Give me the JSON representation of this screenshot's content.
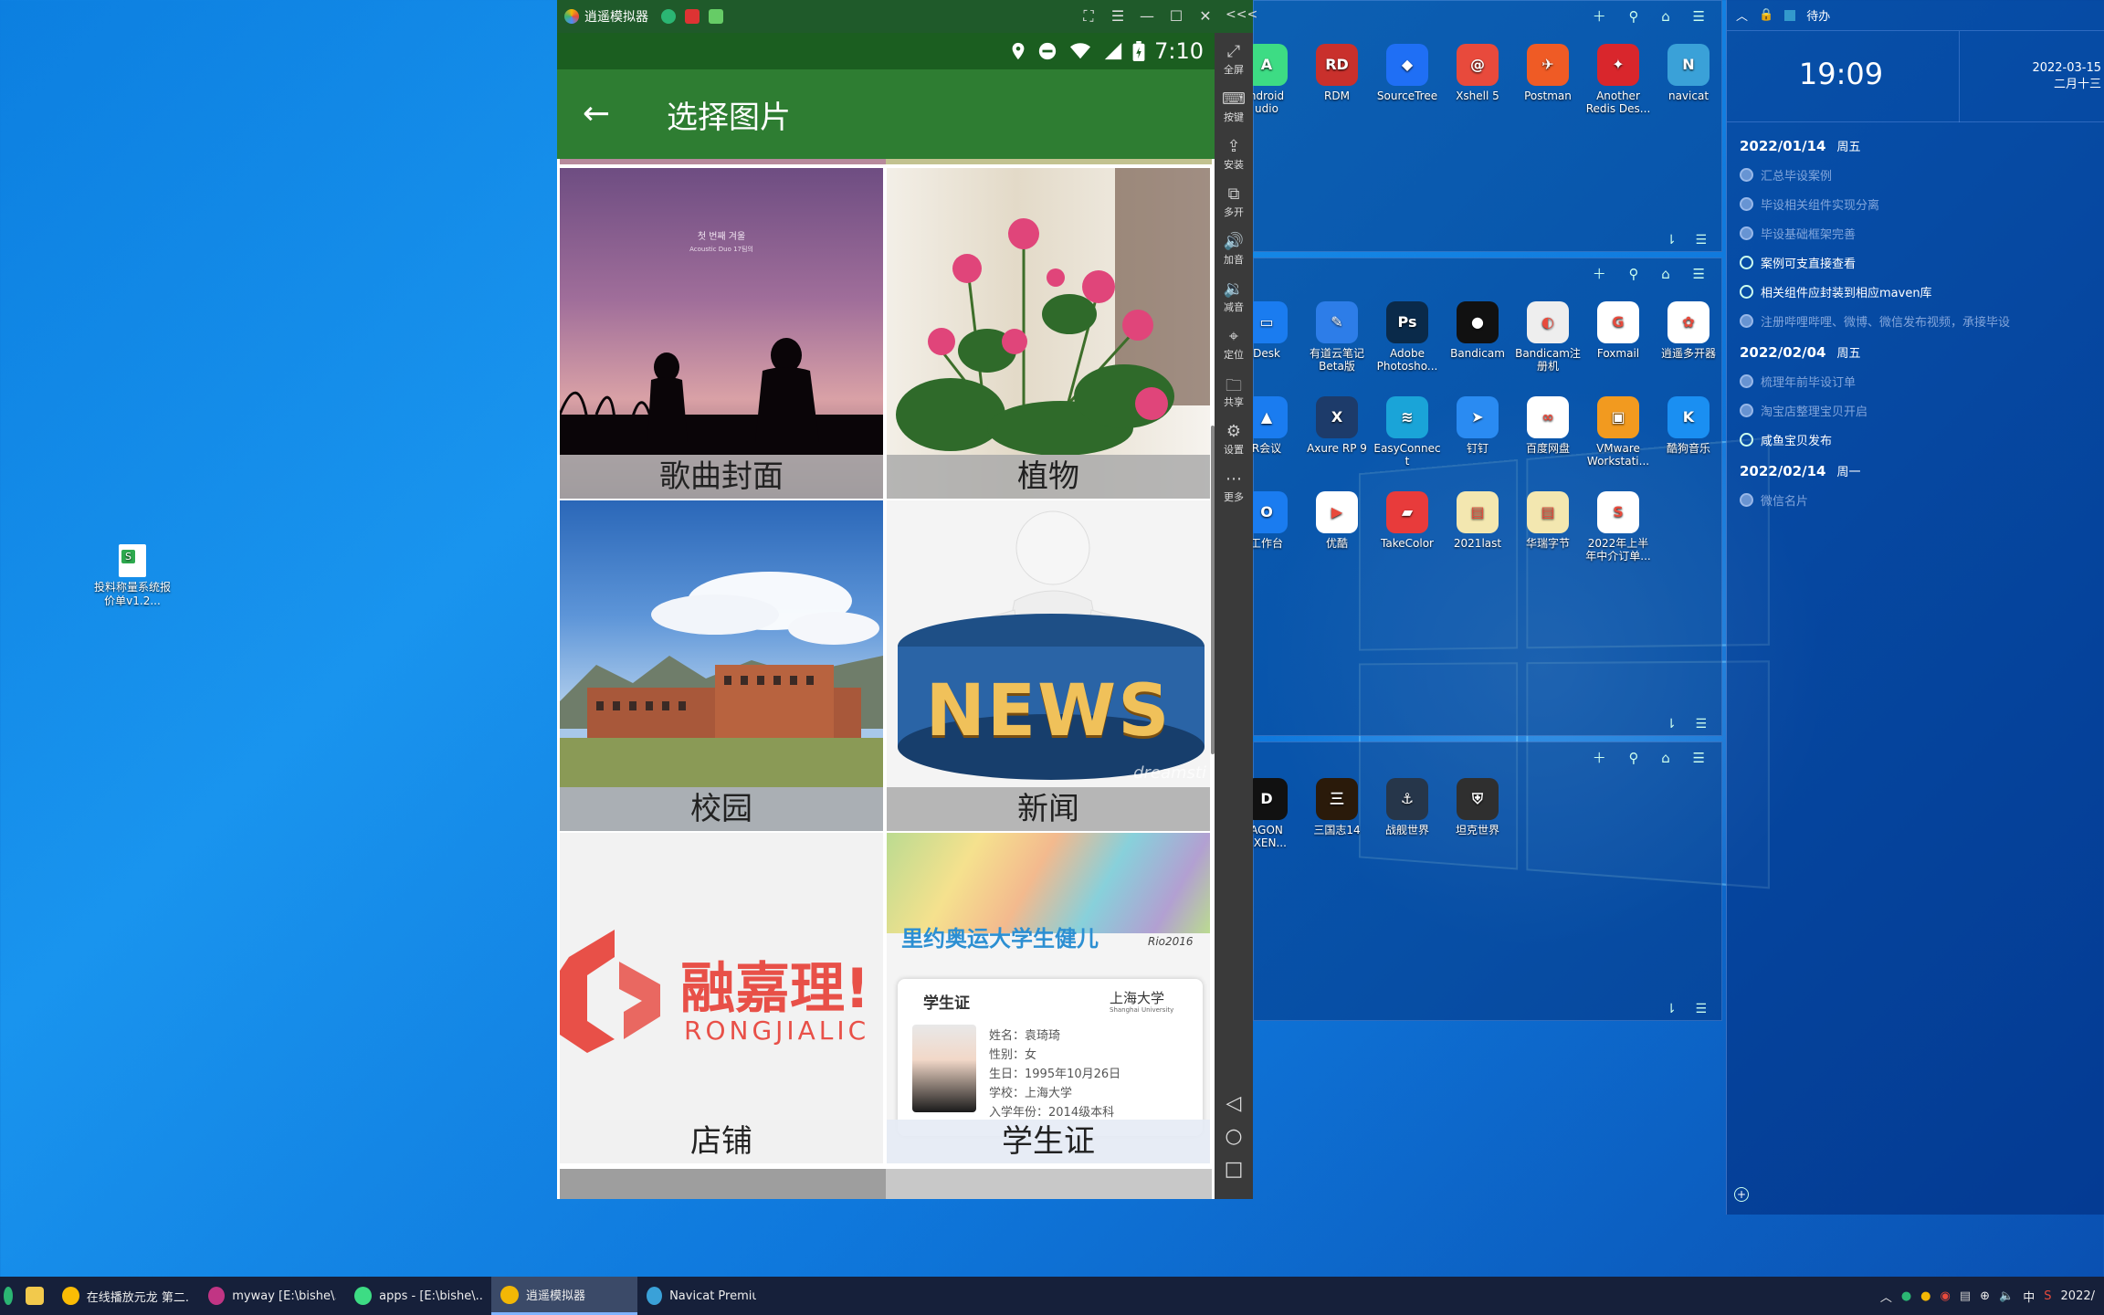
{
  "desktop": {
    "file_icon": {
      "label": "投料称量系统报价单v1.2..."
    }
  },
  "emulator": {
    "title": "逍遥模拟器",
    "status": {
      "time": "7:10"
    },
    "app": {
      "title": "选择图片",
      "tiles": [
        {
          "label": "歌曲封面",
          "art": "song-cover",
          "art_text": "첫 번째 겨울",
          "art_subtext": "Acoustic Duo 17팀의"
        },
        {
          "label": "植物",
          "art": "plant"
        },
        {
          "label": "校园",
          "art": "campus"
        },
        {
          "label": "新闻",
          "art": "news",
          "art_text": "NEWS",
          "watermark": "dreamsti"
        },
        {
          "label": "店铺",
          "art": "shop",
          "art_text": "融嘉理!",
          "art_subtext": "RONGJIALIC"
        },
        {
          "label": "学生证",
          "art": "student-id",
          "banner": "里约奥运大学生健儿",
          "rio": "Rio2016",
          "card_title": "学生证",
          "school_logo": "上海大学",
          "school_en": "Shanghai University",
          "fields": [
            "姓名：袁琦琦",
            "性别：女",
            "生日：1995年10月26日",
            "学校：上海大学",
            "入学年份：2014级本科"
          ]
        }
      ]
    },
    "sidebar": [
      "全屏",
      "按键",
      "安装",
      "多开",
      "加音",
      "减音",
      "定位",
      "共享",
      "设置",
      "更多"
    ],
    "sidebar_top": "<<<"
  },
  "groups": {
    "top": [
      {
        "label": "ndroid\nudio",
        "color": "#3ddc84",
        "glyph": "A"
      },
      {
        "label": "RDM",
        "color": "#c9302c",
        "glyph": "RD"
      },
      {
        "label": "SourceTree",
        "color": "#1f6ff5",
        "glyph": "◆"
      },
      {
        "label": "Xshell 5",
        "color": "#e84a3c",
        "glyph": "@"
      },
      {
        "label": "Postman",
        "color": "#ef5b25",
        "glyph": "✈"
      },
      {
        "label": "Another\nRedis Des...",
        "color": "#d9262c",
        "glyph": "✦"
      },
      {
        "label": "navicat",
        "color": "#3aa1d8",
        "glyph": "N"
      }
    ],
    "mid": [
      {
        "label": "Desk",
        "color": "#1a7cf0",
        "glyph": "▭"
      },
      {
        "label": "有道云笔记\nBeta版",
        "color": "#2d7de8",
        "glyph": "✎"
      },
      {
        "label": "Adobe\nPhotosho...",
        "color": "#0a2a4a",
        "glyph": "Ps"
      },
      {
        "label": "Bandicam",
        "color": "#111",
        "glyph": "●"
      },
      {
        "label": "Bandicam注\n册机",
        "color": "#eee",
        "glyph": "◐"
      },
      {
        "label": "Foxmail",
        "color": "#fff",
        "glyph": "G"
      },
      {
        "label": "逍遥多开器",
        "color": "#fff",
        "glyph": "✿"
      },
      {
        "label": "R会议",
        "color": "#1a7cf0",
        "glyph": "▲"
      },
      {
        "label": "Axure RP 9",
        "color": "#1d3b6a",
        "glyph": "X"
      },
      {
        "label": "EasyConnec\nt",
        "color": "#1aa4d8",
        "glyph": "≋"
      },
      {
        "label": "钉钉",
        "color": "#2a8bf2",
        "glyph": "➤"
      },
      {
        "label": "百度网盘",
        "color": "#fff",
        "glyph": "∞"
      },
      {
        "label": "VMware\nWorkstati...",
        "color": "#f29a1f",
        "glyph": "▣"
      },
      {
        "label": "酷狗音乐",
        "color": "#1a8ff2",
        "glyph": "K"
      },
      {
        "label": "工作台",
        "color": "#1a7cf0",
        "glyph": "O"
      },
      {
        "label": "优酷",
        "color": "#fff",
        "glyph": "▶"
      },
      {
        "label": "TakeColor",
        "color": "#e83b3b",
        "glyph": "▰"
      },
      {
        "label": "2021last",
        "color": "#f3e7b0",
        "glyph": "▤"
      },
      {
        "label": "华瑞字节",
        "color": "#f3e7b0",
        "glyph": "▤"
      },
      {
        "label": "2022年上半\n年中介订单...",
        "color": "#fff",
        "glyph": "S"
      }
    ],
    "low": [
      {
        "label": "AGON\n. XEN...",
        "color": "#111",
        "glyph": "D"
      },
      {
        "label": "三国志14",
        "color": "#2a1a0a",
        "glyph": "三"
      },
      {
        "label": "战舰世界",
        "color": "#26364a",
        "glyph": "⚓"
      },
      {
        "label": "坦克世界",
        "color": "#2f2f2f",
        "glyph": "⛨"
      }
    ]
  },
  "todo": {
    "header": "待办",
    "time": "19:09",
    "date": "2022-03-15",
    "lunar": "二月十三",
    "days": [
      {
        "date": "2022/01/14",
        "weekday": "周五",
        "items": [
          {
            "text": "汇总毕设案例",
            "done": true
          },
          {
            "text": "毕设相关组件实现分离",
            "done": true
          },
          {
            "text": "毕设基础框架完善",
            "done": true
          },
          {
            "text": "案例可支直接查看",
            "done": false
          },
          {
            "text": "相关组件应封装到相应maven库",
            "done": false
          },
          {
            "text": "注册哔哩哔哩、微博、微信发布视频，承接毕设",
            "done": true
          }
        ]
      },
      {
        "date": "2022/02/04",
        "weekday": "周五",
        "items": [
          {
            "text": "梳理年前毕设订单",
            "done": true
          },
          {
            "text": "淘宝店整理宝贝开启",
            "done": true
          },
          {
            "text": "咸鱼宝贝发布",
            "done": false
          }
        ]
      },
      {
        "date": "2022/02/14",
        "weekday": "周一",
        "items": [
          {
            "text": "微信名片",
            "done": true
          }
        ]
      }
    ]
  },
  "taskbar": {
    "items": [
      {
        "label": "在线播放元龙 第二...",
        "color": "#fbbc05"
      },
      {
        "label": "myway [E:\\bishe\\...",
        "color": "#c13584"
      },
      {
        "label": "apps - [E:\\bishe\\...",
        "color": "#3ddc84"
      },
      {
        "label": "逍遥模拟器",
        "color": "#f2b705",
        "active": true
      },
      {
        "label": "Navicat Premium",
        "color": "#3aa1d8"
      }
    ],
    "ime": "中",
    "clock": "2022/"
  }
}
